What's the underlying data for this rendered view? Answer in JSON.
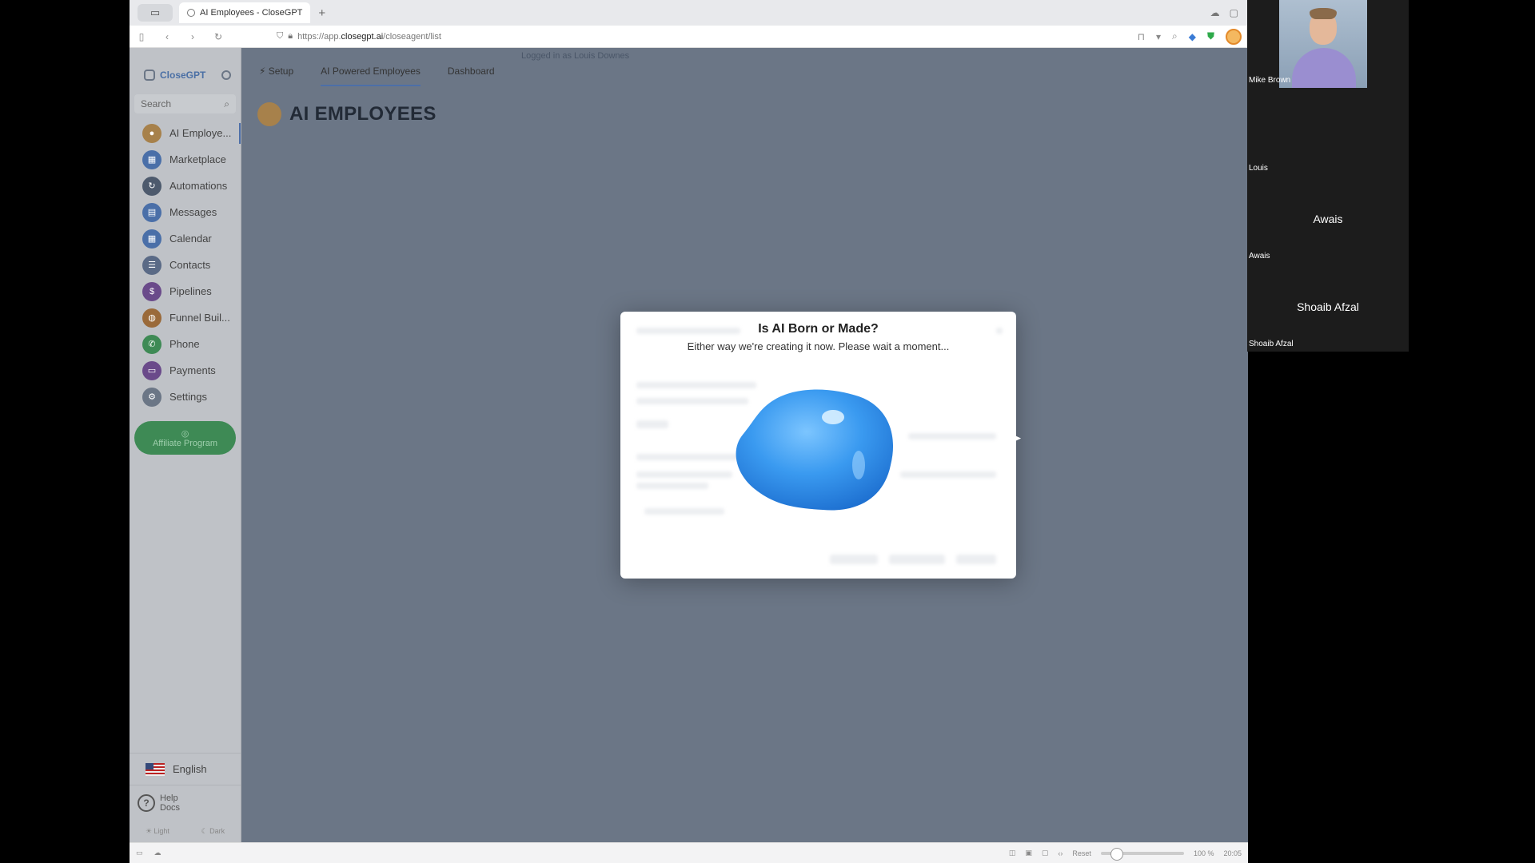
{
  "browser": {
    "tab_title": "AI Employees - CloseGPT",
    "url_prefix": "https://app.",
    "url_domain": "closegpt.ai",
    "url_path": "/closeagent/list"
  },
  "sidebar": {
    "brand": "CloseGPT",
    "search_placeholder": "Search",
    "items": [
      {
        "label": "AI Employe...",
        "color": "#a7814b",
        "icon": "pin"
      },
      {
        "label": "Marketplace",
        "color": "#4a6fa8",
        "icon": "store"
      },
      {
        "label": "Automations",
        "color": "#4d5a6d",
        "icon": "cycle"
      },
      {
        "label": "Messages",
        "color": "#4a6fa8",
        "icon": "chat"
      },
      {
        "label": "Calendar",
        "color": "#4a6fa8",
        "icon": "calendar"
      },
      {
        "label": "Contacts",
        "color": "#5a6a86",
        "icon": "contact"
      },
      {
        "label": "Pipelines",
        "color": "#6a4a8a",
        "icon": "dollar"
      },
      {
        "label": "Funnel Buil...",
        "color": "#9a6a3a",
        "icon": "globe"
      },
      {
        "label": "Phone",
        "color": "#3e8a55",
        "icon": "phone"
      },
      {
        "label": "Payments",
        "color": "#6a4a8a",
        "icon": "card"
      },
      {
        "label": "Settings",
        "color": "#6b7686",
        "icon": "gear"
      }
    ],
    "affiliate_label": "Affiliate Program",
    "language": "English",
    "help_label": "Help",
    "docs_label": "Docs",
    "light_label": "Light",
    "dark_label": "Dark"
  },
  "topnav": {
    "tabs": [
      "Setup",
      "AI Powered Employees",
      "Dashboard"
    ],
    "logged_in": "Logged in as Louis Downes"
  },
  "page": {
    "title": "AI EMPLOYEES"
  },
  "modal": {
    "title": "Is AI Born or Made?",
    "subtitle": "Either way we're creating it now. Please wait a moment..."
  },
  "statusbar": {
    "reset": "Reset",
    "zoom": "100 %",
    "time": "20:05"
  },
  "participants": [
    {
      "name": "Mike Brown",
      "tile_label": ""
    },
    {
      "name": "Louis",
      "tile_label": ""
    },
    {
      "name": "Awais",
      "tile_label": "Awais"
    },
    {
      "name": "Shoaib Afzal",
      "tile_label": "Shoaib Afzal"
    }
  ]
}
